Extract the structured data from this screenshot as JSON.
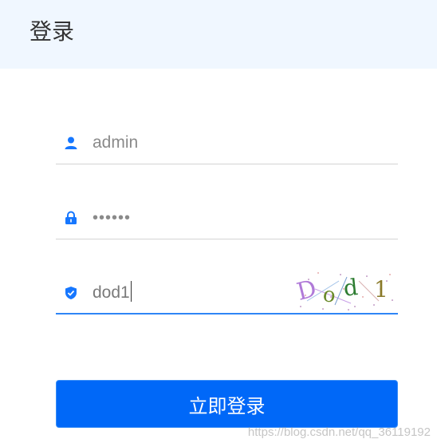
{
  "header": {
    "title": "登录"
  },
  "form": {
    "username": {
      "value": "admin",
      "icon": "user-icon"
    },
    "password": {
      "value": "••••••",
      "icon": "lock-icon"
    },
    "captcha": {
      "value": "dod1",
      "icon": "shield-icon",
      "image_text": "Dod1"
    },
    "submit_label": "立即登录"
  },
  "watermark": "https://blog.csdn.net/qq_36119192",
  "colors": {
    "accent": "#0068f8",
    "icon": "#1677ff",
    "header_bg": "#f0f7ff"
  }
}
